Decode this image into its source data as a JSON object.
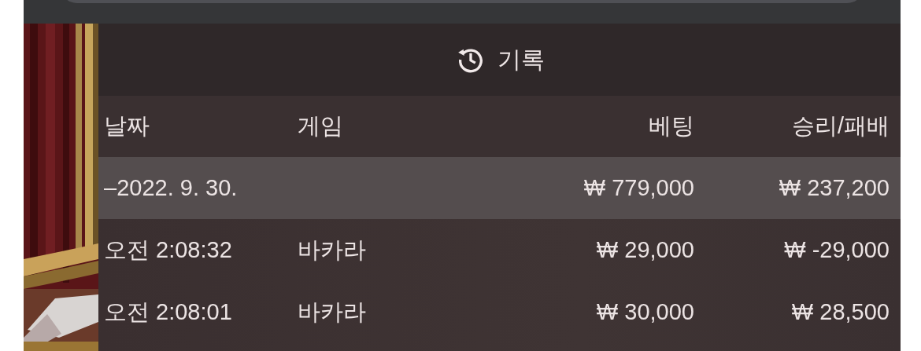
{
  "title": "기록",
  "table": {
    "columns": [
      "날짜",
      "게임",
      "베팅",
      "승리/패배"
    ],
    "rows": [
      {
        "kind": "summary",
        "cells": [
          "–2022. 9. 30.",
          "",
          "₩ 779,000",
          "₩ 237,200"
        ]
      },
      {
        "kind": "entry",
        "cells": [
          "오전 2:08:32",
          "바카라",
          "₩ 29,000",
          "₩ -29,000"
        ]
      },
      {
        "kind": "entry",
        "cells": [
          "오전 2:08:01",
          "바카라",
          "₩ 30,000",
          "₩ 28,500"
        ]
      }
    ]
  }
}
